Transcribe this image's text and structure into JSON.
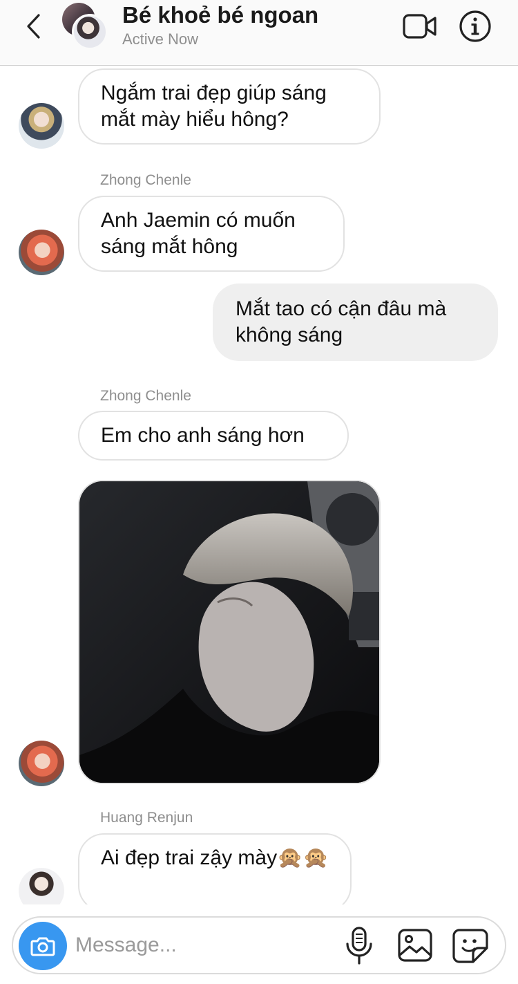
{
  "header": {
    "back_icon": "chevron-left-icon",
    "title": "Bé khoẻ bé ngoan",
    "status": "Active Now",
    "video_icon": "video-camera-icon",
    "info_icon": "info-icon"
  },
  "messages": [
    {
      "type": "incoming",
      "sender": "",
      "text": "Ngắm trai đẹp giúp sáng mắt mày hiểu hông?"
    },
    {
      "type": "incoming",
      "sender": "Zhong Chenle",
      "text": "Anh Jaemin có muốn sáng mắt hông"
    },
    {
      "type": "outgoing",
      "sender": "",
      "text": "Mắt tao có cận đâu mà không sáng"
    },
    {
      "type": "incoming",
      "sender": "Zhong Chenle",
      "text": "Em cho anh sáng hơn"
    },
    {
      "type": "incoming-image",
      "sender": "Zhong Chenle",
      "text": ""
    },
    {
      "type": "incoming",
      "sender": "Huang Renjun",
      "text": "Ai đẹp trai zậy mày🙊🙊"
    }
  ],
  "composer": {
    "placeholder": "Message...",
    "camera_icon": "camera-icon",
    "mic_icon": "microphone-icon",
    "gallery_icon": "gallery-icon",
    "sticker_icon": "sticker-icon"
  },
  "colors": {
    "accent": "#3897f0",
    "incoming_border": "#e2e2e2",
    "outgoing_bg": "#efefef",
    "secondary_text": "#8e8e8e"
  }
}
